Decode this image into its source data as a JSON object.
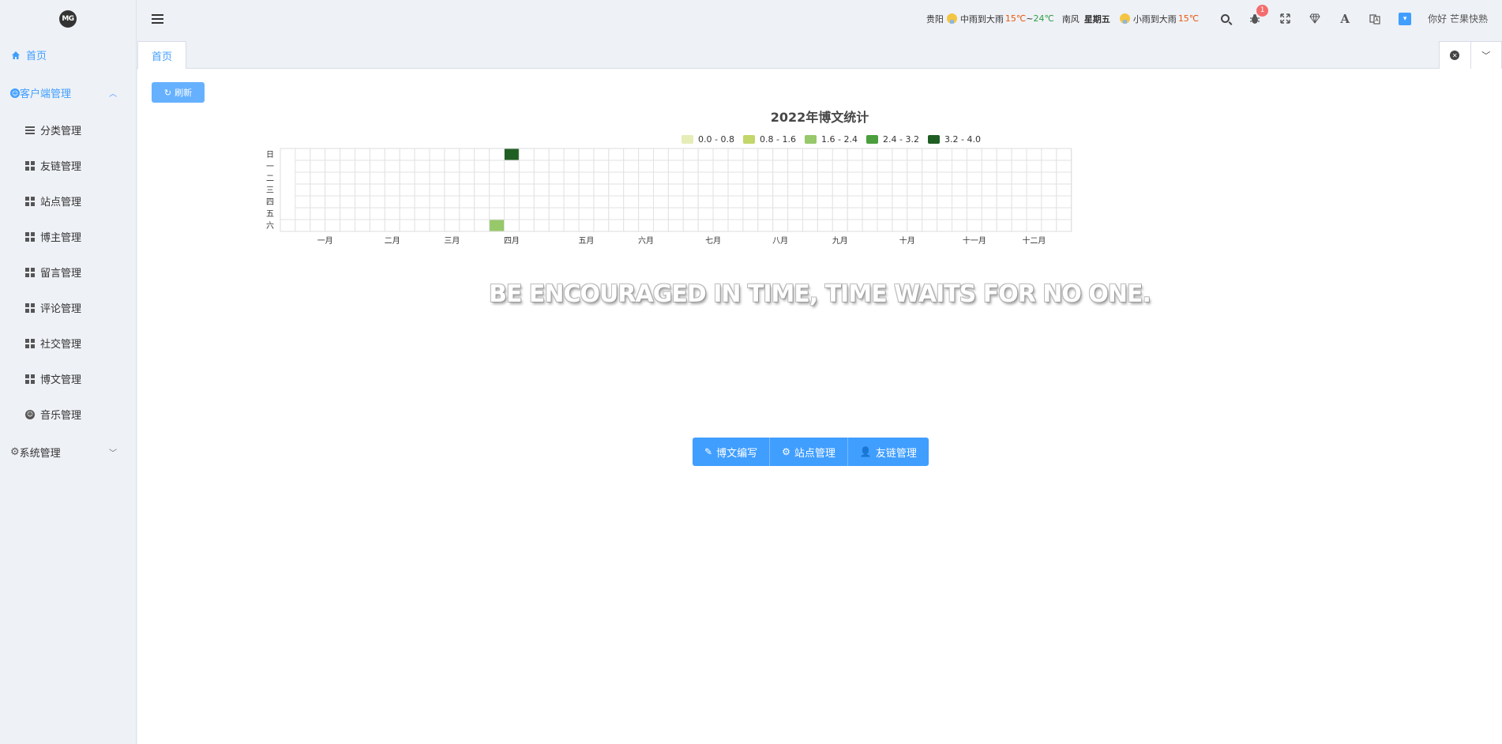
{
  "app": {
    "logo_text": "MG"
  },
  "sidebar": {
    "home": "首页",
    "client_group": "客户端管理",
    "client_items": [
      "分类管理",
      "友链管理",
      "站点管理",
      "博主管理",
      "留言管理",
      "评论管理",
      "社交管理",
      "博文管理",
      "音乐管理"
    ],
    "system_group": "系统管理"
  },
  "header": {
    "city": "贵阳",
    "weather_today": "中雨到大雨",
    "temp_today_low": "15℃",
    "temp_sep": "~",
    "temp_today_high": "24℃",
    "wind": "南风",
    "weekday": "星期五",
    "weather_next": "小雨到大雨",
    "temp_next": "15℃",
    "bug_count": "1",
    "greeting": "你好 芒果快熟",
    "font_icon_glyph": "A"
  },
  "tabs": {
    "home": "首页"
  },
  "toolbar": {
    "refresh": "刷新"
  },
  "chart_data": {
    "type": "heatmap",
    "title": "2022年博文统计",
    "legend": [
      "0.0 - 0.8",
      "0.8 - 1.6",
      "1.6 - 2.4",
      "2.4 - 3.2",
      "3.2 - 4.0"
    ],
    "legend_colors": [
      "#e6edb7",
      "#c2d66a",
      "#97c86a",
      "#4b9f3d",
      "#1f5e22"
    ],
    "weekday_labels": [
      "日",
      "一",
      "二",
      "三",
      "四",
      "五",
      "六"
    ],
    "month_labels": [
      "一月",
      "二月",
      "三月",
      "四月",
      "五月",
      "六月",
      "七月",
      "八月",
      "九月",
      "十月",
      "十一月",
      "十二月"
    ],
    "year": 2022,
    "data": [
      {
        "date": "2022-04-09",
        "value": 2.0
      },
      {
        "date": "2022-04-10",
        "value": 4.0
      }
    ]
  },
  "quote": "BE ENCOURAGED IN TIME, TIME WAITS FOR NO ONE.",
  "quick_buttons": {
    "write": "博文编写",
    "site": "站点管理",
    "links": "友链管理"
  }
}
